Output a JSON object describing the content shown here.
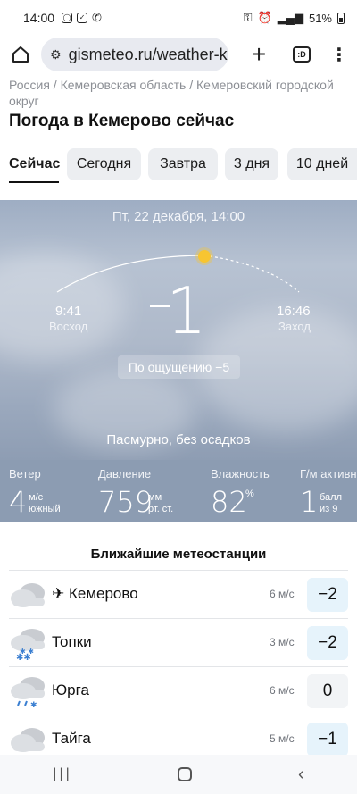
{
  "status_bar": {
    "time": "14:00",
    "battery": "51%"
  },
  "browser": {
    "url": "gismeteo.ru/weather-k",
    "tabs_count": ":D"
  },
  "breadcrumb": {
    "country": "Россия",
    "region": "Кемеровская область",
    "district": "Кемеровский городской округ",
    "sep": " / "
  },
  "page": {
    "title": "Погода в Кемерово сейчас"
  },
  "period_tabs": [
    {
      "label": "Сейчас",
      "active": true
    },
    {
      "label": "Сегодня",
      "active": false
    },
    {
      "label": "Завтра",
      "active": false
    },
    {
      "label": "3 дня",
      "active": false
    },
    {
      "label": "10 дней",
      "active": false
    }
  ],
  "now": {
    "date": "Пт, 22 декабря, 14:00",
    "sunrise_time": "9:41",
    "sunrise_label": "Восход",
    "sunset_time": "16:46",
    "sunset_label": "Заход",
    "temperature": "1",
    "feels_like": "По ощущению −5",
    "condition": "Пасмурно, без осадков"
  },
  "metrics": {
    "wind": {
      "label": "Ветер",
      "value": "4",
      "unit": "м/с",
      "extra": "южный"
    },
    "pressure": {
      "label": "Давление",
      "value": "759",
      "unit": "мм",
      "extra": "рт. ст."
    },
    "humidity": {
      "label": "Влажность",
      "value": "82",
      "unit": "%"
    },
    "geomag": {
      "label": "Г/м активность",
      "value": "1",
      "unit": "балл",
      "extra": "из 9"
    }
  },
  "stations": {
    "title": "Ближайшие метеостанции",
    "rows": [
      {
        "name": "✈ Кемерово",
        "wind": "6 м/с",
        "temp": "−2",
        "icon": "cloudy-icon"
      },
      {
        "name": "Топки",
        "wind": "3 м/с",
        "temp": "−2",
        "icon": "cloud-snow-icon"
      },
      {
        "name": "Юрга",
        "wind": "6 м/с",
        "temp": "0",
        "icon": "cloud-sleet-icon"
      },
      {
        "name": "Тайга",
        "wind": "5 м/с",
        "temp": "−1",
        "icon": "cloudy-icon"
      }
    ]
  }
}
